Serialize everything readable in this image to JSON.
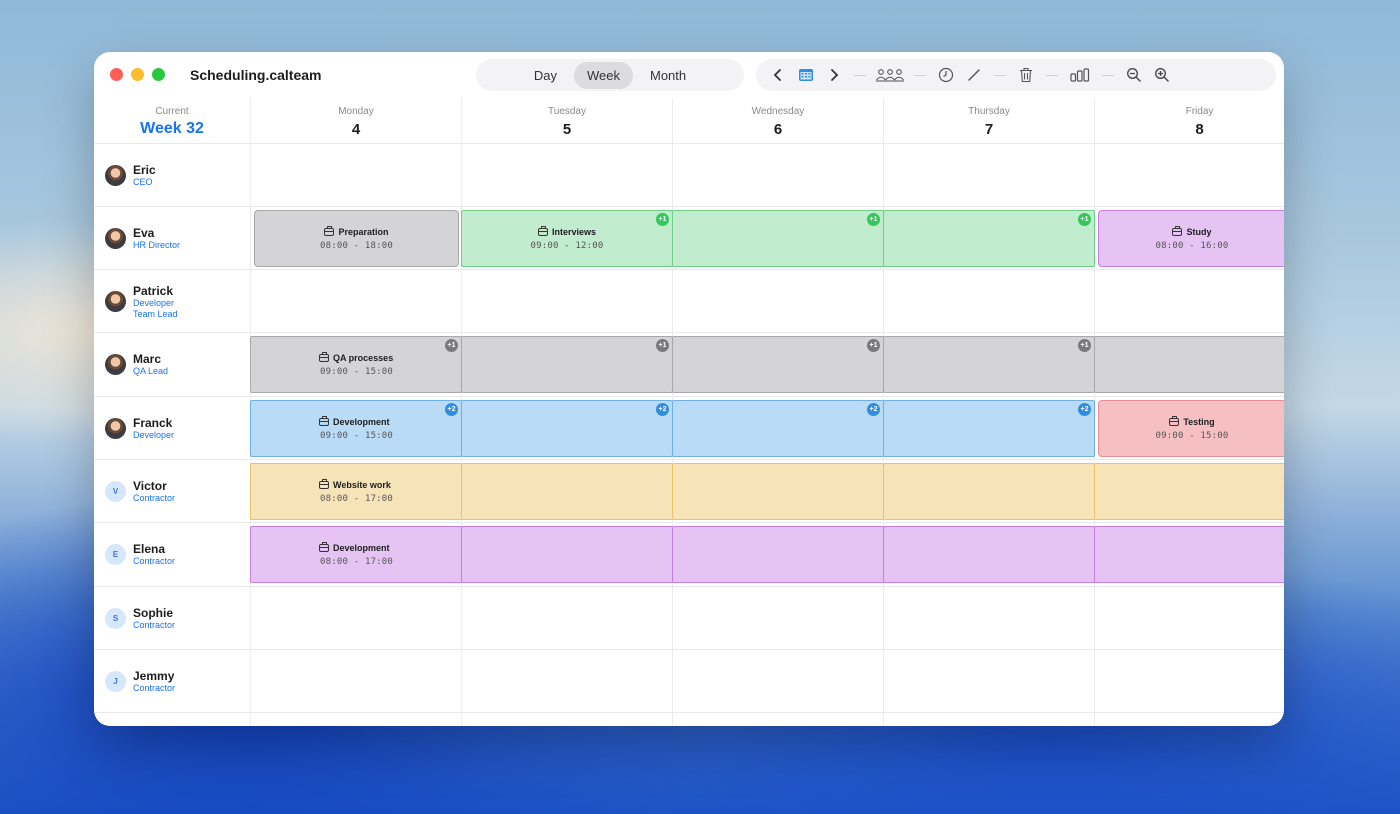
{
  "app": {
    "title": "Scheduling.calteam"
  },
  "view_switch": {
    "options": [
      "Day",
      "Week",
      "Month"
    ],
    "selected": "Week"
  },
  "toolbar": {
    "icons": [
      "chevron-left-icon",
      "calendar-icon",
      "chevron-right-icon",
      "team-icon",
      "clock-icon",
      "pencil-icon",
      "trash-icon",
      "bar-chart-icon",
      "zoom-out-icon",
      "zoom-in-icon"
    ]
  },
  "header": {
    "current_label": "Current",
    "week_label": "Week 32",
    "days": [
      {
        "name": "Monday",
        "num": "4"
      },
      {
        "name": "Tuesday",
        "num": "5"
      },
      {
        "name": "Wednesday",
        "num": "6"
      },
      {
        "name": "Thursday",
        "num": "7"
      },
      {
        "name": "Friday",
        "num": "8"
      }
    ]
  },
  "people": [
    {
      "name": "Eric",
      "role": "CEO",
      "role2": "",
      "avatar": "photo"
    },
    {
      "name": "Eva",
      "role": "HR Director",
      "role2": "",
      "avatar": "photo"
    },
    {
      "name": "Patrick",
      "role": "Developer",
      "role2": "Team Lead",
      "avatar": "photo"
    },
    {
      "name": "Marc",
      "role": "QA Lead",
      "role2": "",
      "avatar": "photo"
    },
    {
      "name": "Franck",
      "role": "Developer",
      "role2": "",
      "avatar": "photo"
    },
    {
      "name": "Victor",
      "role": "Contractor",
      "role2": "",
      "avatar": "V"
    },
    {
      "name": "Elena",
      "role": "Contractor",
      "role2": "",
      "avatar": "E"
    },
    {
      "name": "Sophie",
      "role": "Contractor",
      "role2": "",
      "avatar": "S"
    },
    {
      "name": "Jemmy",
      "role": "Contractor",
      "role2": "",
      "avatar": "J"
    }
  ],
  "events": {
    "eva_prep": {
      "title": "Preparation",
      "time": "08:00 - 18:00"
    },
    "eva_interviews": {
      "title": "Interviews",
      "time": "09:00 - 12:00",
      "badge": "+1"
    },
    "eva_study": {
      "title": "Study",
      "time": "08:00 - 16:00"
    },
    "marc_qa": {
      "title": "QA processes",
      "time": "09:00 - 15:00",
      "badge": "+1"
    },
    "franck_dev": {
      "title": "Development",
      "time": "09:00 - 15:00",
      "badge": "+2"
    },
    "franck_testing": {
      "title": "Testing",
      "time": "09:00 - 15:00"
    },
    "victor_web": {
      "title": "Website work",
      "time": "08:00 - 17:00"
    },
    "elena_dev": {
      "title": "Development",
      "time": "08:00 - 17:00"
    }
  },
  "colors": {
    "accent": "#1a73e8",
    "gray_event": "#d4d4d6",
    "green_event": "#c2ecce",
    "purple_event": "#e5c3f2",
    "blue_event": "#b9dbf6",
    "red_event": "#f6c0c3",
    "yellow_event": "#f6e3b8"
  }
}
